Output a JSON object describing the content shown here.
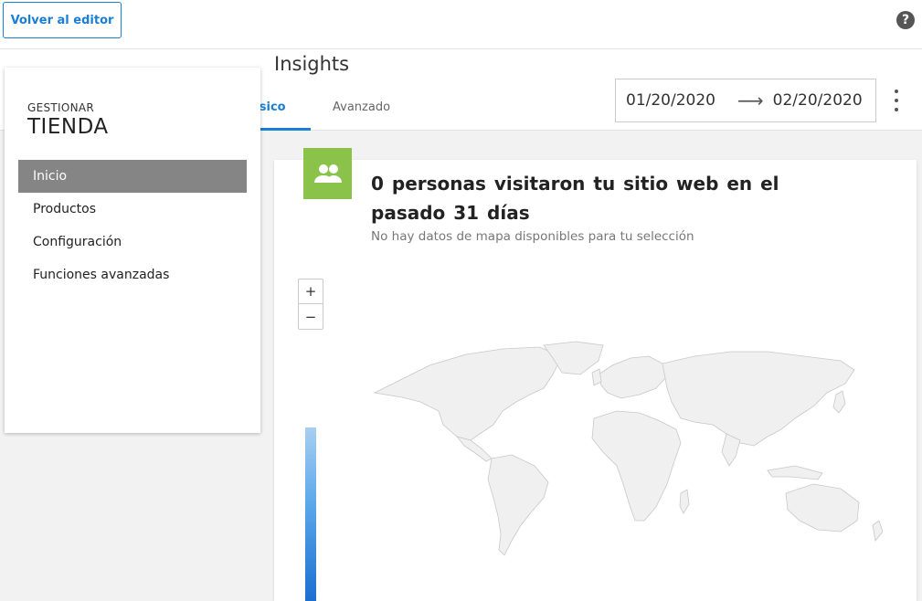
{
  "topbar": {
    "back_label": "Volver al editor",
    "help_glyph": "?"
  },
  "page": {
    "title": "Insights",
    "tabs": [
      {
        "label": "ásico",
        "active": true
      },
      {
        "label": "Avanzado",
        "active": false
      }
    ]
  },
  "date_range": {
    "start": "01/20/2020",
    "arrow": "⟶",
    "end": "02/20/2020"
  },
  "sidebar": {
    "subtitle": "GESTIONAR",
    "title": "TIENDA",
    "items": [
      {
        "label": "Inicio",
        "active": true
      },
      {
        "label": "Productos",
        "active": false
      },
      {
        "label": "Configuración",
        "active": false
      },
      {
        "label": "Funciones avanzadas",
        "active": false
      }
    ]
  },
  "card": {
    "icon": "people-icon",
    "title": "0 personas visitaron tu sitio web en el pasado 31 días",
    "subtitle": "No hay datos de mapa disponibles para tu selección"
  },
  "map": {
    "zoom_in": "+",
    "zoom_out": "−"
  },
  "colors": {
    "accent": "#1a7fd4",
    "icon_bg": "#8bc34a",
    "active_nav": "#858585",
    "land": "#f0f0f0"
  }
}
